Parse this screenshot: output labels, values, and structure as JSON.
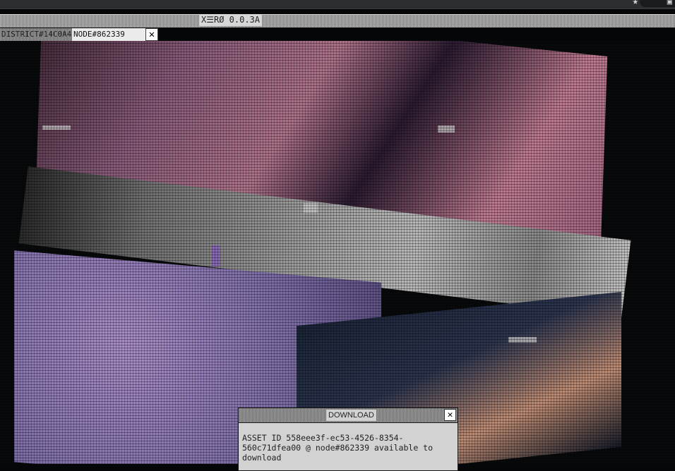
{
  "window": {
    "version_label": "X☰RØ 0.0.3A"
  },
  "tabs": [
    {
      "label": "DISTRICT#14C0A4",
      "active": false
    },
    {
      "label": "NODE#862339",
      "active": true
    }
  ],
  "tab_close_glyph": "✕",
  "browser_chrome": {
    "icon_a": "★",
    "icon_b": "▣"
  },
  "dialog": {
    "title": "DOWNLOAD",
    "close_glyph": "✕",
    "message": "ASSET ID 558eee3f-ec53-4526-8354-560c71dfea00 @ node#862339 available to download"
  },
  "colors": {
    "background": "#050608",
    "dialog_bg": "#d2d2d2",
    "tab_active_bg": "#ececec"
  }
}
